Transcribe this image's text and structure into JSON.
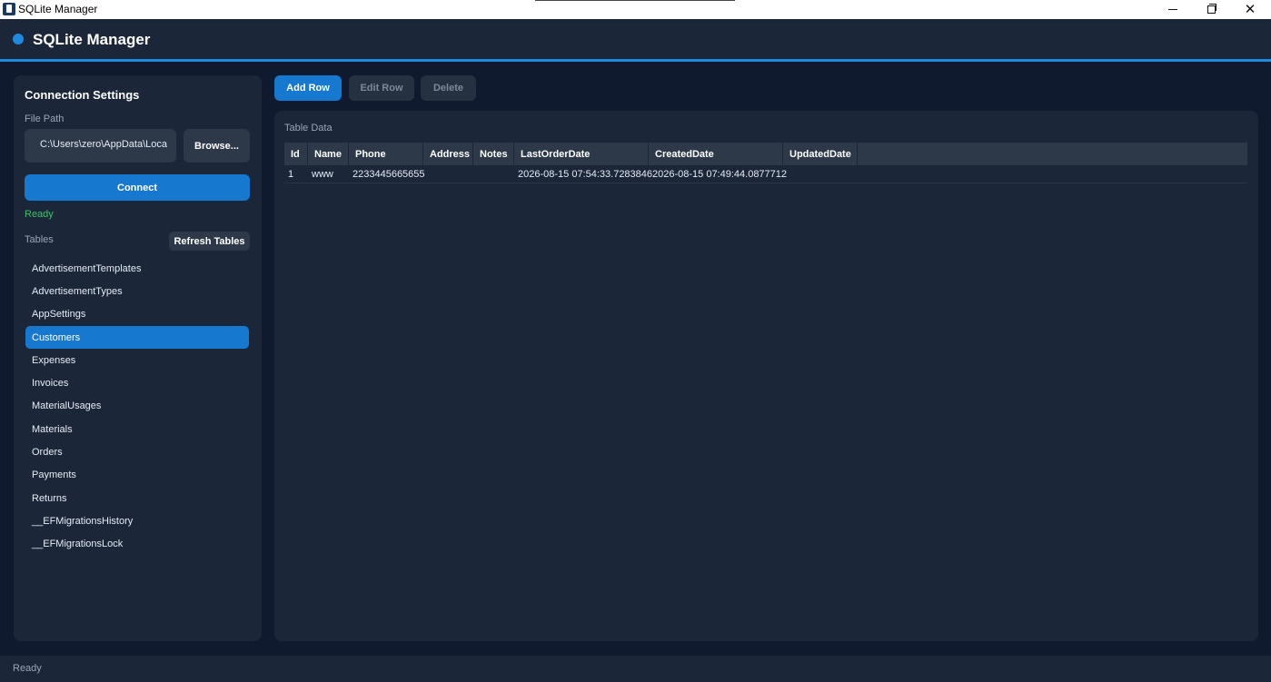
{
  "window": {
    "title": "SQLite Manager",
    "minimize_icon": "minimize-icon",
    "maximize_icon": "restore-icon",
    "close_glyph": "✕"
  },
  "header": {
    "title": "SQLite Manager",
    "accent_color": "#1e8ae0"
  },
  "connection": {
    "heading": "Connection Settings",
    "file_path_label": "File Path",
    "file_path_value": "C:\\Users\\zero\\AppData\\Loca",
    "browse_label": "Browse...",
    "connect_label": "Connect",
    "status": "Ready",
    "status_color": "#35c46a"
  },
  "tables": {
    "label": "Tables",
    "refresh_label": "Refresh Tables",
    "items": [
      "AdvertisementTemplates",
      "AdvertisementTypes",
      "AppSettings",
      "Customers",
      "Expenses",
      "Invoices",
      "MaterialUsages",
      "Materials",
      "Orders",
      "Payments",
      "Returns",
      "__EFMigrationsHistory",
      "__EFMigrationsLock"
    ],
    "selected": "Customers"
  },
  "toolbar": {
    "add_label": "Add Row",
    "edit_label": "Edit Row",
    "delete_label": "Delete"
  },
  "table_data": {
    "label": "Table Data",
    "columns": [
      "Id",
      "Name",
      "Phone",
      "Address",
      "Notes",
      "LastOrderDate",
      "CreatedDate",
      "UpdatedDate"
    ],
    "rows": [
      [
        "1",
        "www",
        "2233445665655",
        "",
        "",
        "2026-08-15 07:54:33.7283846",
        "2026-08-15 07:49:44.0877712",
        ""
      ]
    ]
  },
  "statusbar": {
    "text": "Ready"
  }
}
